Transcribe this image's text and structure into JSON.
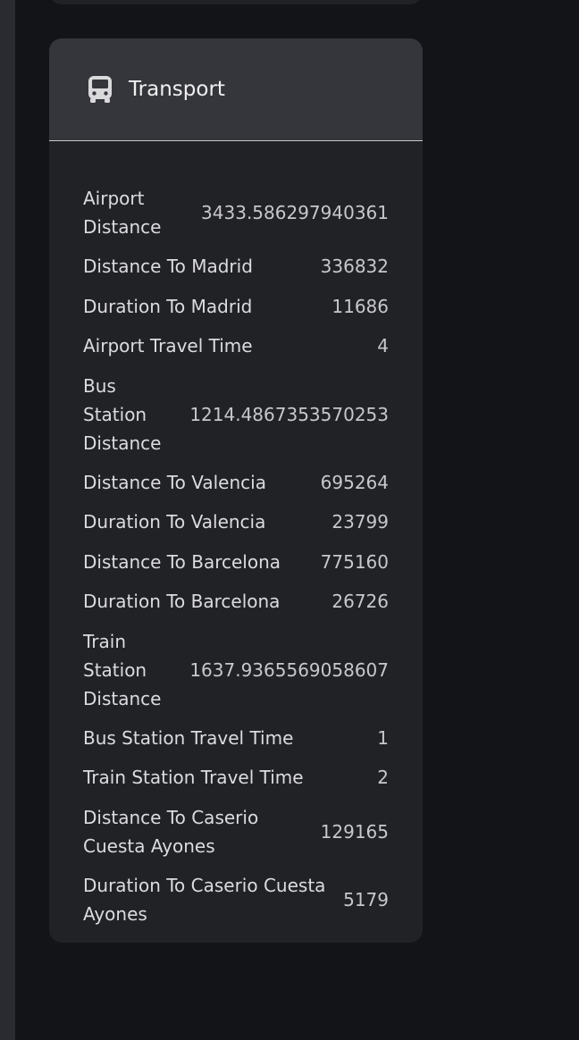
{
  "card": {
    "title": "Transport",
    "icon": "bus-icon"
  },
  "rows": [
    {
      "label": "Airport Distance",
      "value": "3433.586297940361"
    },
    {
      "label": "Distance To Madrid",
      "value": "336832"
    },
    {
      "label": "Duration To Madrid",
      "value": "11686"
    },
    {
      "label": "Airport Travel Time",
      "value": "4"
    },
    {
      "label": "Bus Station Distance",
      "value": "1214.4867353570253"
    },
    {
      "label": "Distance To Valencia",
      "value": "695264"
    },
    {
      "label": "Duration To Valencia",
      "value": "23799"
    },
    {
      "label": "Distance To Barcelona",
      "value": "775160"
    },
    {
      "label": "Duration To Barcelona",
      "value": "26726"
    },
    {
      "label": "Train Station Distance",
      "value": "1637.9365569058607"
    },
    {
      "label": "Bus Station Travel Time",
      "value": "1"
    },
    {
      "label": "Train Station Travel Time",
      "value": "2"
    },
    {
      "label": "Distance To Caserio Cuesta Ayones",
      "value": "129165"
    },
    {
      "label": "Duration To Caserio Cuesta Ayones",
      "value": "5179"
    }
  ]
}
